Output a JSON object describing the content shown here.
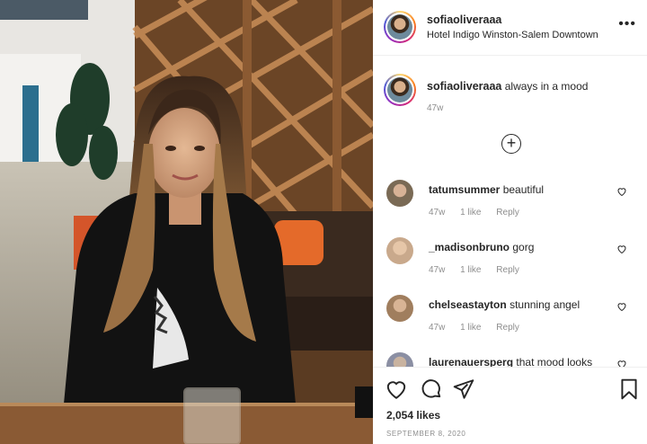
{
  "post": {
    "username": "sofiaoliveraaa",
    "location": "Hotel Indigo Winston-Salem Downtown",
    "more_icon": "more-horizontal-icon"
  },
  "caption": {
    "username": "sofiaoliveraaa",
    "text": "always in a mood",
    "age": "47w"
  },
  "load_more_icon": "plus-circle-icon",
  "comments": [
    {
      "username": "tatumsummer",
      "text": "beautiful",
      "age": "47w",
      "likes": "1 like",
      "reply": "Reply",
      "avatar_color": "#7a6a55"
    },
    {
      "username": "_madisonbruno",
      "text": "gorg",
      "age": "47w",
      "likes": "1 like",
      "reply": "Reply",
      "avatar_color": "#c9a98c"
    },
    {
      "username": "chelseastayton",
      "text": "stunning angel",
      "age": "47w",
      "likes": "1 like",
      "reply": "Reply",
      "avatar_color": "#a07e5e"
    },
    {
      "username": "laurenauersperg",
      "text": "that mood looks",
      "age": "47w",
      "likes": "",
      "reply": "",
      "avatar_color": "#8b8fa3"
    }
  ],
  "actions": {
    "like_icon": "heart-icon",
    "comment_icon": "comment-icon",
    "share_icon": "share-icon",
    "save_icon": "bookmark-icon"
  },
  "likes": "2,054 likes",
  "date": "SEPTEMBER 8, 2020",
  "colors": {
    "text": "#262626",
    "muted": "#8e8e8e",
    "divider": "#efefef"
  }
}
